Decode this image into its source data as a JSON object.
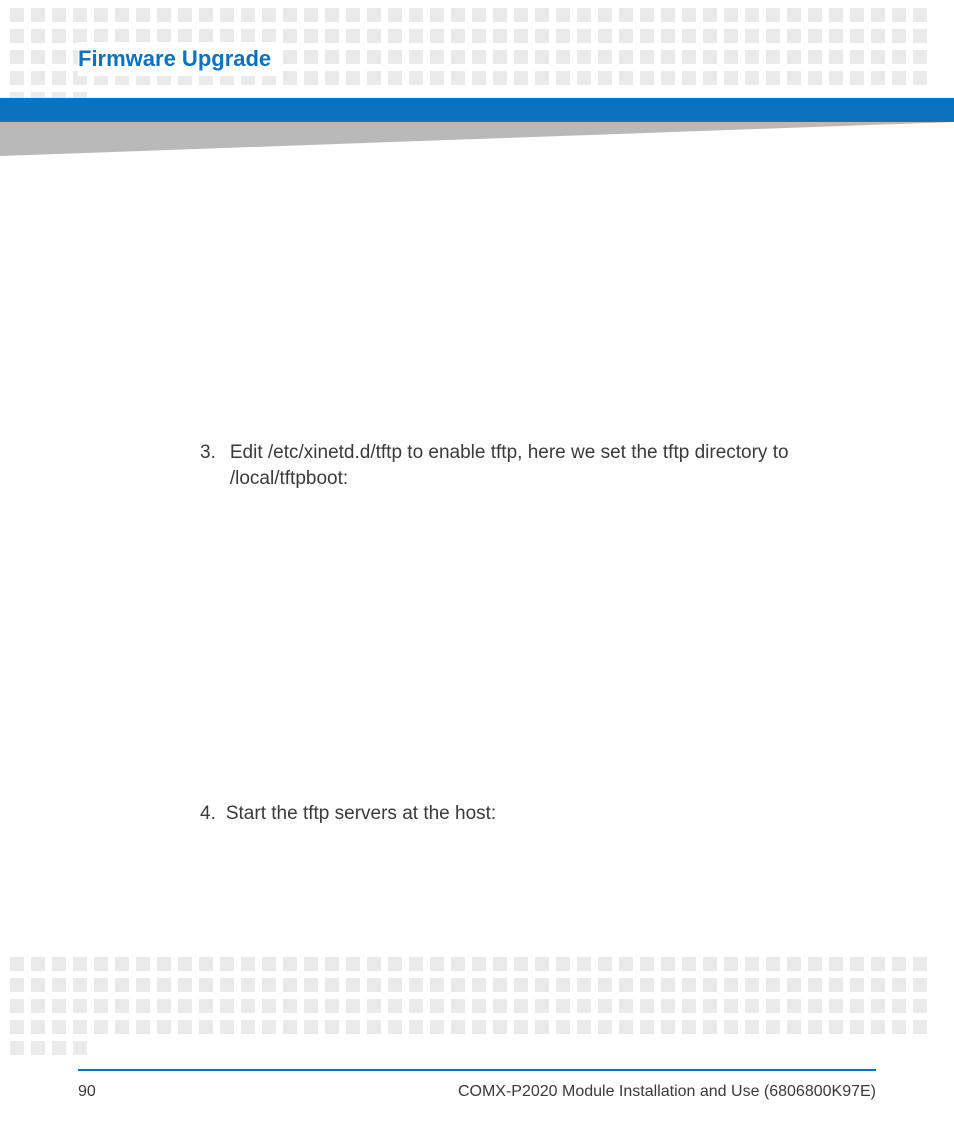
{
  "header": {
    "title": "Firmware Upgrade"
  },
  "content": {
    "step3": {
      "number": "3.",
      "text": "Edit /etc/xinetd.d/tftp to enable tftp, here we set the tftp directory to /local/tftpboot:"
    },
    "step4": {
      "number": "4.",
      "text": "Start the tftp servers at the host:"
    }
  },
  "footer": {
    "page": "90",
    "docref": "COMX-P2020 Module Installation and Use (6806800K97E)"
  },
  "colors": {
    "brand_blue": "#0a72bf",
    "square_gray": "#eaeaea",
    "wedge_gray": "#b9b9b9"
  }
}
